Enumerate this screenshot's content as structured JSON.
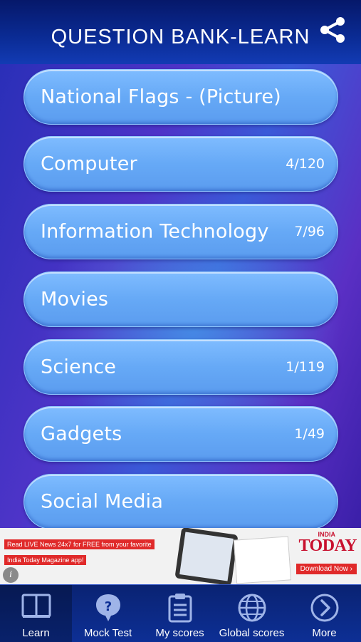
{
  "header": {
    "title": "QUESTION BANK-LEARN",
    "share_icon": "share-icon"
  },
  "categories": [
    {
      "name": "National Flags - (Picture)",
      "progress": ""
    },
    {
      "name": "Computer",
      "progress": "4/120"
    },
    {
      "name": "Information Technology",
      "progress": "7/96"
    },
    {
      "name": "Movies",
      "progress": ""
    },
    {
      "name": "Science",
      "progress": "1/119"
    },
    {
      "name": "Gadgets",
      "progress": "1/49"
    },
    {
      "name": "Social Media",
      "progress": ""
    }
  ],
  "ad": {
    "line1": "Read LIVE News 24x7 for FREE from your favorite",
    "line2": "India Today Magazine app!",
    "brand_top": "INDIA",
    "brand": "TODAY",
    "cta": "Download Now ›",
    "info_icon": "info-icon"
  },
  "tabs": [
    {
      "label": "Learn",
      "icon": "book-icon",
      "active": true
    },
    {
      "label": "Mock Test",
      "icon": "question-bubble-icon",
      "active": false
    },
    {
      "label": "My scores",
      "icon": "clipboard-icon",
      "active": false
    },
    {
      "label": "Global scores",
      "icon": "globe-icon",
      "active": false
    },
    {
      "label": "More",
      "icon": "chevron-right-circle-icon",
      "active": false
    }
  ],
  "colors": {
    "header": "#0a2a92",
    "button": "#66a9f6",
    "tabbar": "#0d2f95",
    "ad_red": "#e02a2a"
  }
}
